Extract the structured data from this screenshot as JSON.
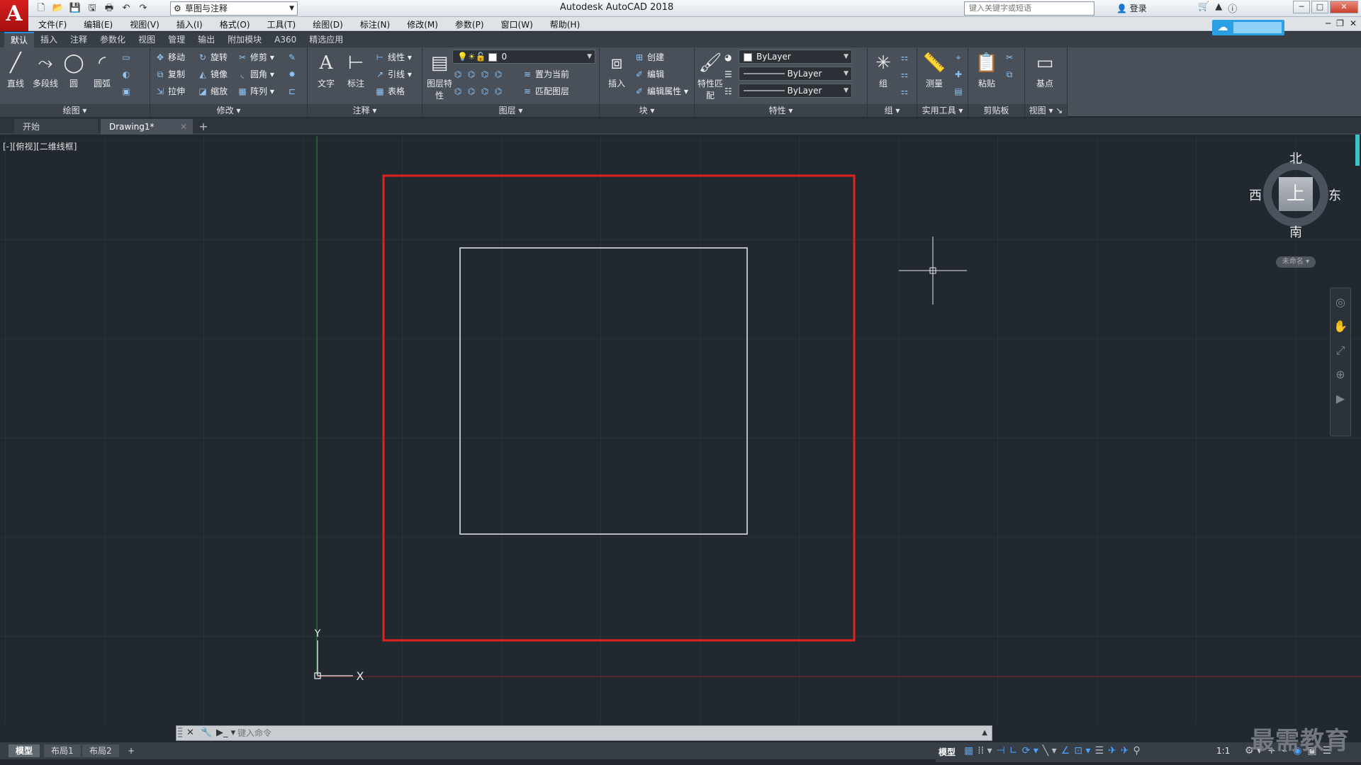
{
  "window": {
    "title": "Autodesk AutoCAD 2018",
    "logo": "A",
    "workspace": "草图与注释",
    "search_placeholder": "键入关键字或短语",
    "login": "登录"
  },
  "menu": [
    "文件(F)",
    "编辑(E)",
    "视图(V)",
    "插入(I)",
    "格式(O)",
    "工具(T)",
    "绘图(D)",
    "标注(N)",
    "修改(M)",
    "参数(P)",
    "窗口(W)",
    "帮助(H)"
  ],
  "ribbon_tabs": [
    "默认",
    "插入",
    "注释",
    "参数化",
    "视图",
    "管理",
    "输出",
    "附加模块",
    "A360",
    "精选应用"
  ],
  "ribbon": {
    "draw": {
      "title": "绘图",
      "line": "直线",
      "polyline": "多段线",
      "circle": "圆",
      "arc": "圆弧"
    },
    "modify": {
      "title": "修改",
      "move": "移动",
      "rotate": "旋转",
      "trim": "修剪",
      "copy": "复制",
      "mirror": "镜像",
      "fillet": "圆角",
      "stretch": "拉伸",
      "scale": "缩放",
      "array": "阵列"
    },
    "annotation": {
      "title": "注释",
      "text": "文字",
      "dimension": "标注",
      "linear": "线性",
      "leader": "引线",
      "table": "表格"
    },
    "layers": {
      "title": "图层",
      "layer_properties": "图层特性",
      "current_layer": "0",
      "make_current": "置为当前",
      "match_layer": "匹配图层"
    },
    "block": {
      "title": "块",
      "insert": "插入",
      "create": "创建",
      "edit": "编辑",
      "edit_attributes": "编辑属性"
    },
    "properties": {
      "title": "特性",
      "match_properties": "特性匹配",
      "color": "ByLayer",
      "linetype": "ByLayer",
      "lineweight": "ByLayer"
    },
    "groups": {
      "title": "组",
      "group": "组"
    },
    "utilities": {
      "title": "实用工具",
      "measure": "测量"
    },
    "clipboard": {
      "title": "剪贴板",
      "paste": "粘贴"
    },
    "view": {
      "title": "视图",
      "base": "基点"
    }
  },
  "file_tabs": [
    {
      "label": "开始"
    },
    {
      "label": "Drawing1*"
    }
  ],
  "viewport_label": "[-][俯视][二维线框]",
  "viewcube": {
    "face": "上",
    "north": "北",
    "south": "南",
    "east": "东",
    "west": "西",
    "wcs": "未命名"
  },
  "ucs": {
    "x_label": "X",
    "y_label": "Y"
  },
  "command_line": {
    "placeholder": "键入命令"
  },
  "layout_tabs": [
    "模型",
    "布局1",
    "布局2"
  ],
  "status_bar": {
    "model": "模型",
    "scale": "1:1"
  },
  "watermark": "最需教育",
  "colors": {
    "canvas_bg": "#212830",
    "outer_rect": "#e0231f",
    "inner_rect": "#e9e9e9",
    "y_axis": "#2f8a3a",
    "x_axis": "#7a2a2a",
    "accent": "#2f8ee0"
  }
}
